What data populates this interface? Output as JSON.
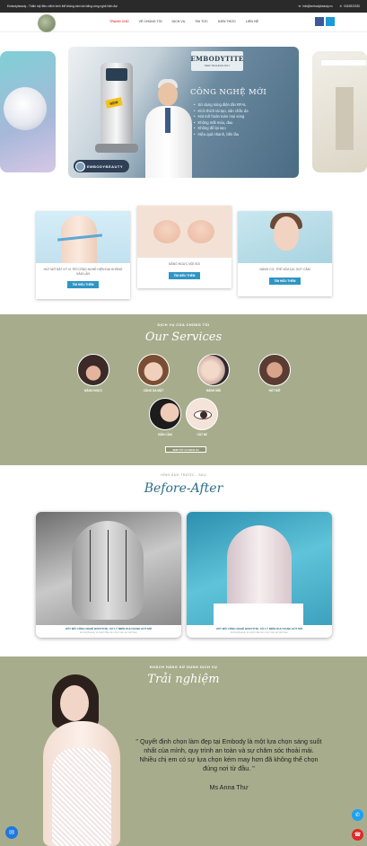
{
  "topbar": {
    "tagline": "Embodybeauty - Thẩm mỹ điều chỉnh hình thể không xâm lấn bằng công nghệ hiện đại",
    "email": "info@embodybeauty.vn",
    "phone": "0343922330"
  },
  "nav": {
    "items": [
      "TRANG CHỦ",
      "VỀ CHÚNG TÔI",
      "DỊCH VỤ",
      "TIN TỨC",
      "KIẾN THỨC",
      "LIÊN HỆ"
    ]
  },
  "hero": {
    "brand": "EMBODYTITE",
    "brand_sub": "NEW TECHNOLOGY",
    "badge": "NEW",
    "title": "CÔNG NGHỆ MỚI",
    "bullets": [
      "Sử dụng sóng điện tần RFAL",
      "Kích thích tái tạo, săn chắc da",
      "Hút mỡ hoàn toàn mọi vùng",
      "Không mất máu, đau",
      "Không để lại sẹo",
      "Hiệu quả nhanh, bền lâu"
    ],
    "logo_text": "EMBODYBEAUTY"
  },
  "cards": [
    {
      "caption": "HÚT MỠ BẤT KỲ VỊ TRÍ CÔNG NGHỆ HIỆN ĐẠI KHÔNG XÂM LẤN",
      "button": "TÌM HIỂU THÊM"
    },
    {
      "caption": "NÂNG NGỰC NỘI SOI",
      "button": "TÌM HIỂU THÊM"
    },
    {
      "caption": "NÂNG CƠ, TRẺ HÓA DA, GỌT CẰM",
      "button": "TÌM HIỂU THÊM"
    }
  ],
  "services": {
    "subtitle": "DỊCH VỤ CỦA CHÚNG TÔI",
    "title": "Our Services",
    "items": [
      "NÂNG NGỰC",
      "CĂNG DA MẶT",
      "NÂNG MŨI",
      "HÚT MỠ",
      "ĐỘN CẰM",
      "CẮT MÍ"
    ],
    "button": "XEM TẤT CẢ DỊCH VỤ"
  },
  "before_after": {
    "subtitle": "HÌNH ẢNH TRƯỚC - SAU",
    "title": "Before-After",
    "items": [
      {
        "title": "HÚT MỠ CÔNG NGHỆ BODYTITE, XỬ LÝ MIỄN KHU RẠNG HÚT MỠ",
        "meta": "Embodybeauty là người đầu tiên thực hiện tại Việt Nam"
      },
      {
        "title": "HÚT MỠ CÔNG NGHỆ BODYTITE, XỬ LÝ MIỄN KHU RẠNG HÚT MỠ",
        "meta": "Embodybeauty là người đầu tiên thực hiện tại Việt Nam"
      }
    ]
  },
  "testimonial": {
    "subtitle": "KHÁCH HÀNG SỬ DỤNG DỊCH VỤ",
    "title": "Trải nghiệm",
    "quote": "\" Quyết định chọn làm đẹp tại Embody là một lựa chọn sáng suốt nhất của mình, quy trình an toàn và sự chăm sóc thoải mái. Nhiều chị em có sự lựa chọn kém may hơn đã không thể chọn đúng nơi từ đầu. \"",
    "author": "Ms Anna Thư"
  },
  "colors": {
    "accent": "#2e95c4",
    "olive": "#a7ad8c",
    "teal_title": "#2b6d86",
    "nav_active": "#d9534f"
  }
}
